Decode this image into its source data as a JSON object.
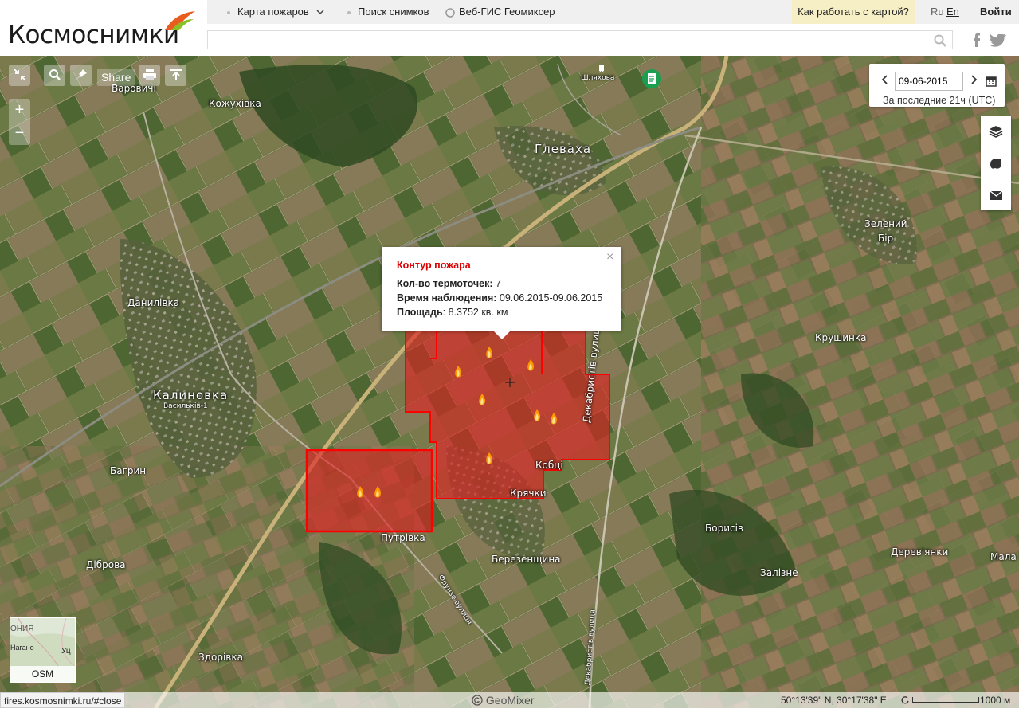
{
  "header": {
    "brand": "Космоснимки",
    "nav": {
      "fires_map": "Карта пожаров",
      "search_images": "Поиск снимков",
      "web_gis": "Веб-ГИС Геомиксер",
      "how_to": "Как работать с картой?",
      "lang_ru": "Ru",
      "lang_en": "En",
      "login": "Войти"
    },
    "search_value": ""
  },
  "map_controls": {
    "share": "Share",
    "zoom_in": "+",
    "zoom_out": "−"
  },
  "date_panel": {
    "date_value": "09-06-2015",
    "subtitle": "За последние 21ч (UTC)"
  },
  "popup": {
    "title": "Контур пожара",
    "hotspots_label": "Кол-во термоточек:",
    "hotspots_value": "7",
    "time_label": "Время наблюдения:",
    "time_value": "09.06.2015-09.06.2015",
    "area_label": "Площадь",
    "area_value": ": 8.3752 кв. км",
    "close": "×"
  },
  "places": {
    "varovichi": "Варовичі",
    "kozhukhivka": "Кожухівка",
    "shlyakhova": "Шляхова",
    "glevakha": "Глеваха",
    "zelenyi_bir_1": "Зелений",
    "zelenyi_bir_2": "Бір",
    "danylivka": "Данилівка",
    "krushynka": "Крушинка",
    "kalynovka": "Калиновка",
    "vasylkiv": "Васильків-1",
    "bagryn": "Багрин",
    "kobtsi": "Кобці",
    "kryachky": "Крячки",
    "dekabrystiv_1": "Декабристів вулиця",
    "dekabrystiv_2": "Декабристів вулиця",
    "putrivka": "Путрівка",
    "borysiv": "Борисів",
    "berezenshchyna": "Березенщина",
    "derevyanky": "Дерев'янки",
    "mala_ber": "Мала Б",
    "dibrova": "Діброва",
    "frunze": "Фрунзе вулиця",
    "zalizne": "Залізне",
    "zdorivka": "Здорівка"
  },
  "minimap": {
    "label": "OSM",
    "text_1": "ОНИЯ",
    "text_2": "Нагано",
    "text_3": "Уц"
  },
  "status": {
    "url": "fires.kosmosnimki.ru/#close",
    "geomixer": "GeoMixer",
    "coords": "50°13'39\" N, 30°17'38\" E",
    "scale": "1000 м"
  },
  "colors": {
    "fire_fill": "#e02020",
    "fire_stroke": "#ff0000",
    "popup_title": "#dd0000",
    "howto_bg": "#f6efc6"
  }
}
